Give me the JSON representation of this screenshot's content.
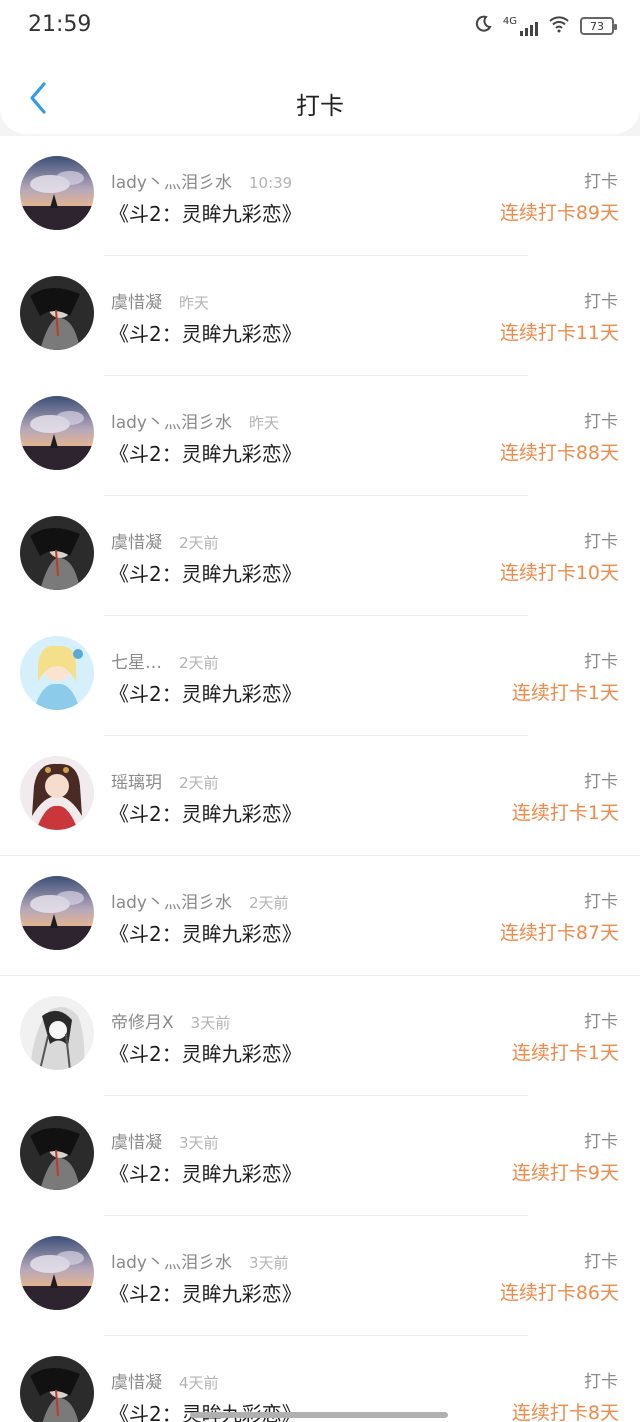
{
  "status": {
    "time": "21:59",
    "battery": "73",
    "network": "4G"
  },
  "header": {
    "title": "打卡"
  },
  "colors": {
    "accent": "#ef8a4a",
    "back": "#2f9bea"
  },
  "list": [
    {
      "user": "lady丶灬泪彡水",
      "time": "10:39",
      "book": "《斗2：灵眸九彩恋》",
      "tag": "打卡",
      "streak": "连续打卡89天",
      "avatar": "sky-sunset"
    },
    {
      "user": "虞惜凝",
      "time": "昨天",
      "book": "《斗2：灵眸九彩恋》",
      "tag": "打卡",
      "streak": "连续打卡11天",
      "avatar": "dark-figure"
    },
    {
      "user": "lady丶灬泪彡水",
      "time": "昨天",
      "book": "《斗2：灵眸九彩恋》",
      "tag": "打卡",
      "streak": "连续打卡88天",
      "avatar": "sky-sunset"
    },
    {
      "user": "虞惜凝",
      "time": "2天前",
      "book": "《斗2：灵眸九彩恋》",
      "tag": "打卡",
      "streak": "连续打卡10天",
      "avatar": "dark-figure"
    },
    {
      "user": "七星…",
      "time": "2天前",
      "book": "《斗2：灵眸九彩恋》",
      "tag": "打卡",
      "streak": "连续打卡1天",
      "avatar": "anime-blue"
    },
    {
      "user": "瑶璃玥",
      "time": "2天前",
      "book": "《斗2：灵眸九彩恋》",
      "tag": "打卡",
      "streak": "连续打卡1天",
      "avatar": "anime-red"
    },
    {
      "user": "lady丶灬泪彡水",
      "time": "2天前",
      "book": "《斗2：灵眸九彩恋》",
      "tag": "打卡",
      "streak": "连续打卡87天",
      "avatar": "sky-sunset"
    },
    {
      "user": "帝修月X",
      "time": "3天前",
      "book": "《斗2：灵眸九彩恋》",
      "tag": "打卡",
      "streak": "连续打卡1天",
      "avatar": "mono-sketch"
    },
    {
      "user": "虞惜凝",
      "time": "3天前",
      "book": "《斗2：灵眸九彩恋》",
      "tag": "打卡",
      "streak": "连续打卡9天",
      "avatar": "dark-figure"
    },
    {
      "user": "lady丶灬泪彡水",
      "time": "3天前",
      "book": "《斗2：灵眸九彩恋》",
      "tag": "打卡",
      "streak": "连续打卡86天",
      "avatar": "sky-sunset"
    },
    {
      "user": "虞惜凝",
      "time": "4天前",
      "book": "《斗2：灵眸九彩恋》",
      "tag": "打卡",
      "streak": "连续打卡8天",
      "avatar": "dark-figure"
    }
  ]
}
